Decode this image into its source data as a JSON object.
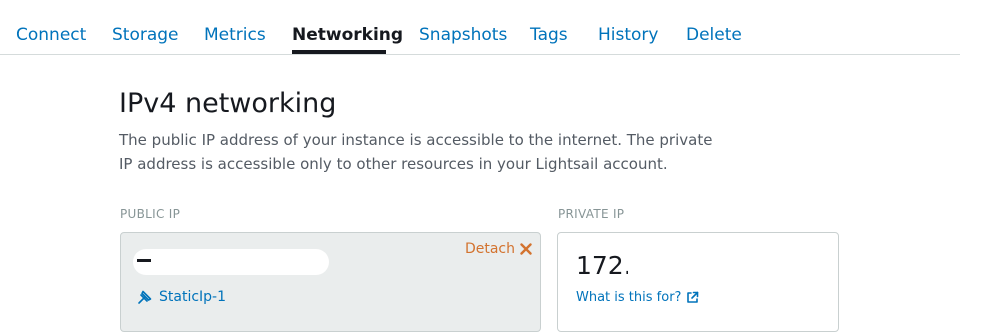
{
  "tabs": [
    {
      "label": "Connect",
      "active": false
    },
    {
      "label": "Storage",
      "active": false
    },
    {
      "label": "Metrics",
      "active": false
    },
    {
      "label": "Networking",
      "active": true
    },
    {
      "label": "Snapshots",
      "active": false
    },
    {
      "label": "Tags",
      "active": false
    },
    {
      "label": "History",
      "active": false
    },
    {
      "label": "Delete",
      "active": false
    }
  ],
  "section": {
    "title": "IPv4 networking",
    "description": "The public IP address of your instance is accessible to the internet. The private IP address is accessible only to other resources in your Lightsail account."
  },
  "public_ip": {
    "label": "PUBLIC IP",
    "detach_label": "Detach",
    "static_ip_name": "StaticIp-1"
  },
  "private_ip": {
    "label": "PRIVATE IP",
    "value_prefix": "172.",
    "help_link": "What is this for?"
  },
  "colors": {
    "link": "#0073bb",
    "accent_orange": "#d3732f",
    "text": "#16191f",
    "muted": "#545b64"
  },
  "icons": {
    "detach": "close-x-icon",
    "static_ip": "pin-icon",
    "external": "external-link-icon"
  }
}
